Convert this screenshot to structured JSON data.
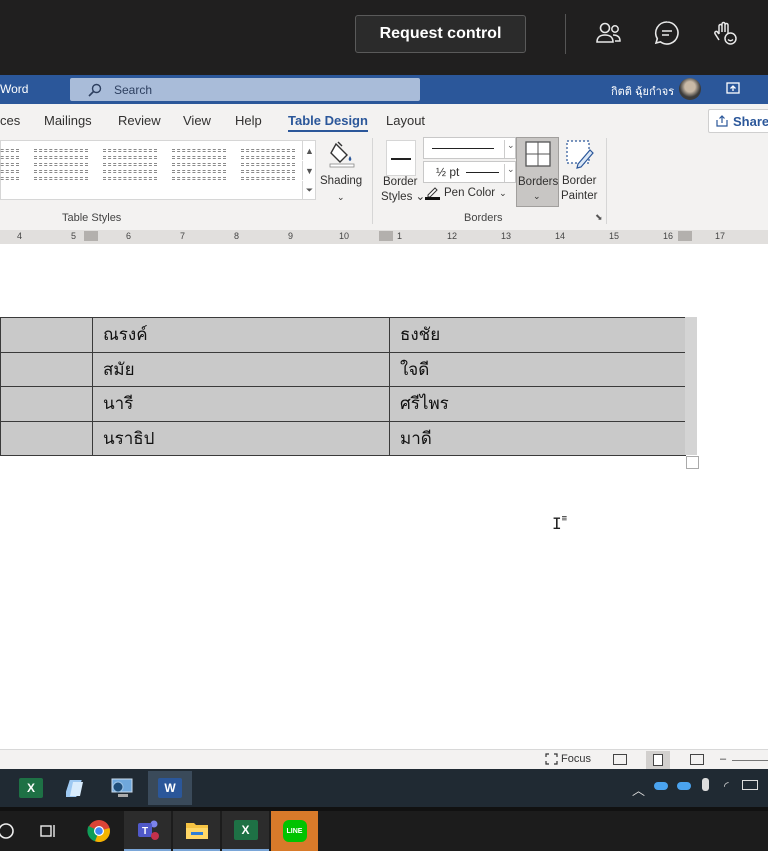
{
  "teams": {
    "request_control": "Request control"
  },
  "word_title": {
    "app_name": "Word",
    "search_placeholder": "Search",
    "user_name": "กิตติ ฉุ้ยกำจร"
  },
  "ribbon": {
    "tabs": [
      {
        "label": "ces"
      },
      {
        "label": "Mailings"
      },
      {
        "label": "Review"
      },
      {
        "label": "View"
      },
      {
        "label": "Help"
      },
      {
        "label": "Table Design",
        "active": true
      },
      {
        "label": "Layout"
      }
    ],
    "share_label": "Share",
    "shading_label": "Shading",
    "table_styles_group": "Table Styles",
    "border_styles_label_1": "Border",
    "border_styles_label_2": "Styles",
    "line_weight": "½ pt",
    "pen_color_label": "Pen Color",
    "borders_label": "Borders",
    "border_painter_label_1": "Border",
    "border_painter_label_2": "Painter",
    "borders_group": "Borders"
  },
  "ruler": {
    "numbers": [
      "4",
      "5",
      "6",
      "7",
      "8",
      "9",
      "10",
      "1",
      "12",
      "13",
      "14",
      "15",
      "16",
      "17"
    ]
  },
  "table": {
    "rows": [
      {
        "first": "ณรงค์",
        "last": "ธงชัย"
      },
      {
        "first": "สมัย",
        "last": "ใจดี"
      },
      {
        "first": "นารี",
        "last": "ศรีไพร"
      },
      {
        "first": "นราธิป",
        "last": "มาดี"
      }
    ]
  },
  "statusbar": {
    "focus_label": "Focus"
  },
  "colors": {
    "word_blue": "#2b579a",
    "cell_shading": "#c9c9c9",
    "teams_bar": "#201f1f"
  }
}
